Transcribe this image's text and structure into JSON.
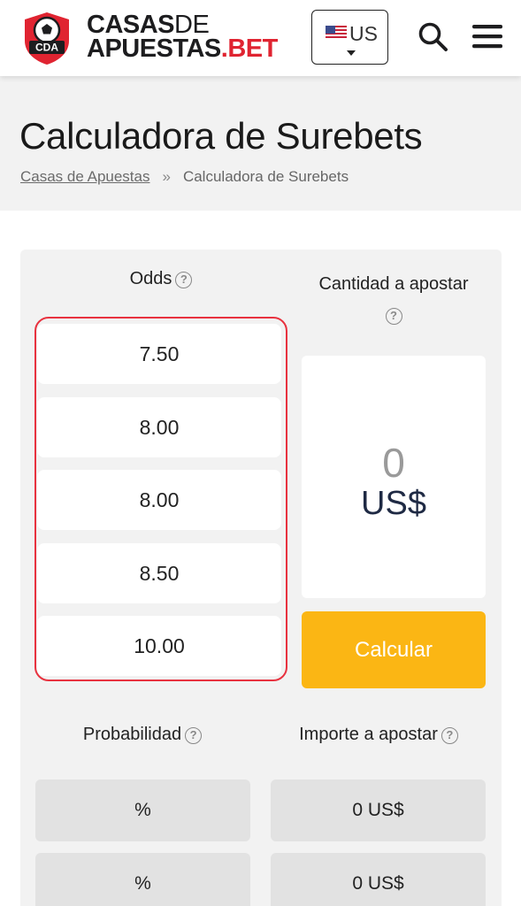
{
  "header": {
    "logo": {
      "line1_bold": "CASAS",
      "line1_thin": "DE",
      "line2_dark": "APUESTAS",
      "line2_red": ".BET",
      "badge_text": "CDA"
    },
    "language": {
      "label": "US",
      "flag_icon": "us-flag-icon"
    },
    "icons": [
      "search-icon",
      "hamburger-menu-icon"
    ]
  },
  "page": {
    "title": "Calculadora de Surebets",
    "breadcrumb": {
      "home": "Casas de Apuestas",
      "separator": "»",
      "current": "Calculadora de Surebets"
    }
  },
  "calculator": {
    "odds_header": "Odds",
    "amount_header": "Cantidad a apostar",
    "odds": [
      "7.50",
      "8.00",
      "8.00",
      "8.50",
      "10.00"
    ],
    "amount_value": "0",
    "amount_currency": "US$",
    "calculate_label": "Calcular",
    "probability_header": "Probabilidad",
    "stake_header": "Importe a apostar",
    "help_symbol": "?",
    "results": [
      {
        "probability": "%",
        "stake": "0 US$"
      },
      {
        "probability": "%",
        "stake": "0 US$"
      }
    ]
  },
  "colors": {
    "accent_red": "#e02431",
    "button_yellow": "#fbb614",
    "highlight_border": "#e8323f"
  }
}
